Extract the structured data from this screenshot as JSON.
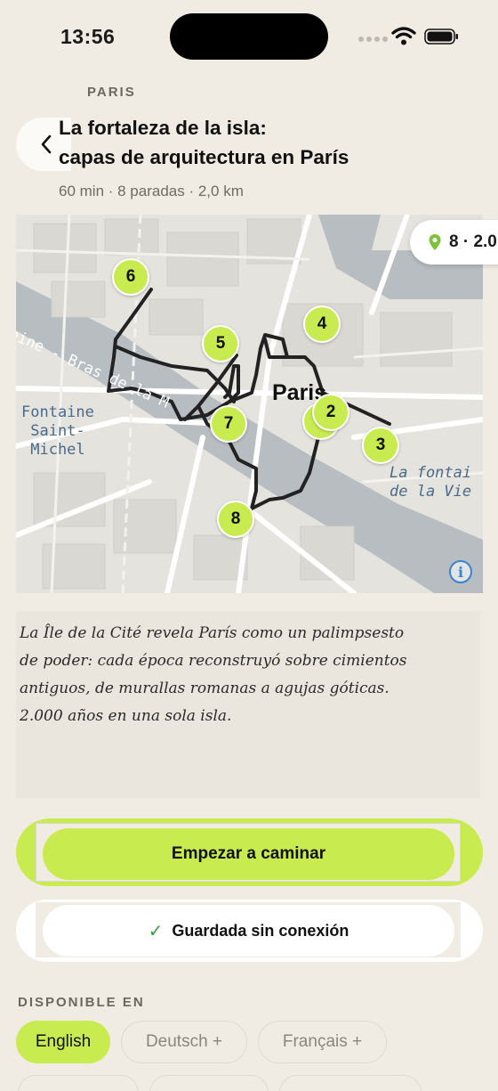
{
  "status_bar": {
    "time": "13:56"
  },
  "header": {
    "city": "PARIS",
    "title_line1": "La fortaleza de la isla:",
    "title_line2": "capas de arquitectura en París",
    "meta": "60 min · 8 paradas · 2,0 km"
  },
  "map": {
    "labels": {
      "paris": "Paris",
      "fontaine_1": "Fontaine",
      "fontaine_2": "Saint-",
      "fontaine_3": "Michel",
      "seine": "Seine - Bras de la M",
      "fontaine_right_1": "La fontai",
      "fontaine_right_2": "de la Vie"
    },
    "pins": [
      "6",
      "5",
      "4",
      "7",
      "1",
      "2",
      "3",
      "8"
    ],
    "badge": "8 · 2.0",
    "route_color": "#222222",
    "pin_color": "#c8ec50"
  },
  "description": {
    "line1": "La Île de la Cité revela París como un palimpsesto",
    "line2": "de poder: cada época reconstruyó sobre cimientos",
    "line3": "antiguos, de murallas romanas a agujas góticas.",
    "line4": "2.000 años en una sola isla."
  },
  "actions": {
    "start": "Empezar a caminar",
    "saved": "Guardada sin conexión",
    "saved_check": "✓"
  },
  "languages": {
    "label": "DISPONIBLE EN",
    "items": [
      {
        "name": "English",
        "active": true
      },
      {
        "name": "Deutsch +",
        "active": false
      },
      {
        "name": "Français +",
        "active": false
      }
    ]
  },
  "colors": {
    "accent": "#c8ec50",
    "background": "#f1ece3"
  }
}
